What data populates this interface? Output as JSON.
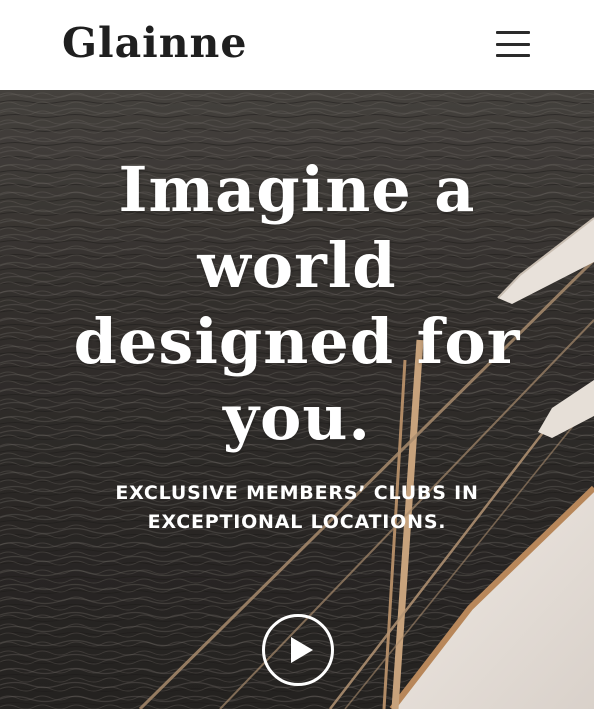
{
  "header": {
    "logo": "Glainne",
    "menu_icon": "hamburger-menu-icon"
  },
  "hero": {
    "headline": "Imagine a world designed for you.",
    "subhead_line1": "Exclusive members’ clubs in",
    "subhead_line2": "exceptional locations.",
    "play_icon": "play-icon",
    "background": "sailing-boat-on-dark-sea-photo"
  },
  "colors": {
    "header_bg": "#ffffff",
    "logo_text": "#1f1f1f",
    "hero_text": "#ffffff",
    "sea_dark": "#2f2c2a"
  }
}
